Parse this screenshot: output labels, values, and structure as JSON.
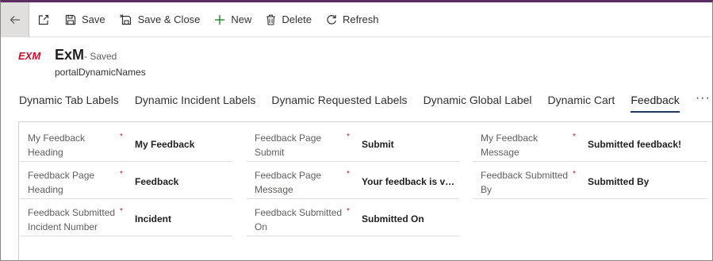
{
  "commands": {
    "save": "Save",
    "save_close": "Save & Close",
    "new": "New",
    "delete": "Delete",
    "refresh": "Refresh"
  },
  "header": {
    "logo_text": "EXM",
    "title": "ExM",
    "status": "- Saved",
    "subtitle": "portalDynamicNames"
  },
  "tabs": [
    {
      "label": "Dynamic Tab Labels"
    },
    {
      "label": "Dynamic Incident Labels"
    },
    {
      "label": "Dynamic Requested Labels"
    },
    {
      "label": "Dynamic Global Label"
    },
    {
      "label": "Dynamic Cart"
    },
    {
      "label": "Feedback",
      "active": true
    }
  ],
  "more_tabs": "···",
  "form": {
    "required_mark": "*",
    "columns": [
      [
        {
          "label": "My Feedback Heading",
          "value": "My Feedback"
        },
        {
          "label": "Feedback Page Heading",
          "value": "Feedback"
        },
        {
          "label": "Feedback Submitted Incident Number",
          "value": "Incident"
        }
      ],
      [
        {
          "label": "Feedback Page Submit",
          "value": "Submit"
        },
        {
          "label": "Feedback Page Message",
          "value": "Your feedback is val..."
        },
        {
          "label": "Feedback Submitted On",
          "value": "Submitted On"
        }
      ],
      [
        {
          "label": "My Feedback Message",
          "value": "Submitted feedback!"
        },
        {
          "label": "Feedback Submitted By",
          "value": "Submitted By"
        }
      ]
    ]
  },
  "colors": {
    "accent": "#5c2d62",
    "active_tab_underline": "#1f3864",
    "logo_red": "#c8102e",
    "required": "#a4262c"
  },
  "icons": [
    "back-arrow-icon",
    "popout-icon",
    "save-icon",
    "save-close-icon",
    "plus-icon",
    "trash-icon",
    "refresh-icon"
  ]
}
